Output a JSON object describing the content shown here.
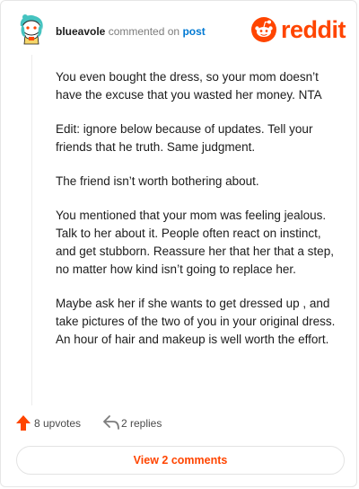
{
  "comment": {
    "author": "blueavole",
    "verb": "commented on",
    "post_link": "post",
    "paragraphs": [
      "You even bought the dress, so your mom doesn’t have the excuse that you wasted her money. NTA",
      "Edit: ignore below because of updates. Tell your friends that he truth. Same judgment.",
      "The friend isn’t worth bothering about.",
      "You mentioned that your mom was feeling jealous. Talk to her about it. People often react on instinct, and get stubborn. Reassure her that her that a step, no matter how kind isn’t going to replace her.",
      "Maybe ask her if she wants to get dressed up , and take pictures of the two of you in your original dress. An hour of hair and makeup is well worth the effort."
    ]
  },
  "brand": {
    "logo_text": "reddit",
    "accent": "#ff4500"
  },
  "actions": {
    "upvotes_label": "8 upvotes",
    "replies_label": "2 replies",
    "view_comments_label": "View 2 comments"
  },
  "icons": {
    "avatar": "snoo-avatar-icon",
    "logo": "reddit-logo-icon",
    "upvote": "upvote-arrow-icon",
    "reply": "reply-arrow-icon"
  }
}
